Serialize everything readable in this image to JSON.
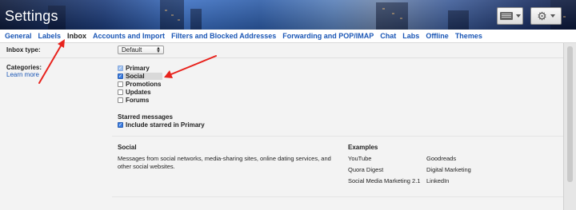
{
  "header": {
    "title": "Settings",
    "keyboard_button_icon": "keyboard-icon",
    "settings_button_icon": "gear-icon"
  },
  "tabs": [
    {
      "label": "General",
      "active": false
    },
    {
      "label": "Labels",
      "active": false
    },
    {
      "label": "Inbox",
      "active": true
    },
    {
      "label": "Accounts and Import",
      "active": false
    },
    {
      "label": "Filters and Blocked Addresses",
      "active": false
    },
    {
      "label": "Forwarding and POP/IMAP",
      "active": false
    },
    {
      "label": "Chat",
      "active": false
    },
    {
      "label": "Labs",
      "active": false
    },
    {
      "label": "Offline",
      "active": false
    },
    {
      "label": "Themes",
      "active": false
    }
  ],
  "inbox_type": {
    "label": "Inbox type:",
    "selected": "Default"
  },
  "categories": {
    "label": "Categories:",
    "learn_more": "Learn more",
    "options": [
      {
        "label": "Primary",
        "checked": true,
        "disabled": true
      },
      {
        "label": "Social",
        "checked": true,
        "disabled": false
      },
      {
        "label": "Promotions",
        "checked": false,
        "disabled": false
      },
      {
        "label": "Updates",
        "checked": false,
        "disabled": false
      },
      {
        "label": "Forums",
        "checked": false,
        "disabled": false
      }
    ]
  },
  "starred": {
    "heading": "Starred messages",
    "option_label": "Include starred in Primary",
    "checked": true
  },
  "info": {
    "title": "Social",
    "description": "Messages from social networks, media-sharing sites, online dating services, and other social websites.",
    "examples_title": "Examples",
    "examples_col1": [
      "YouTube",
      "Quora Digest",
      "Social Media Marketing 2.1"
    ],
    "examples_col2": [
      "Goodreads",
      "Digital Marketing",
      "LinkedIn"
    ]
  },
  "annotation_color": "#e8231d"
}
